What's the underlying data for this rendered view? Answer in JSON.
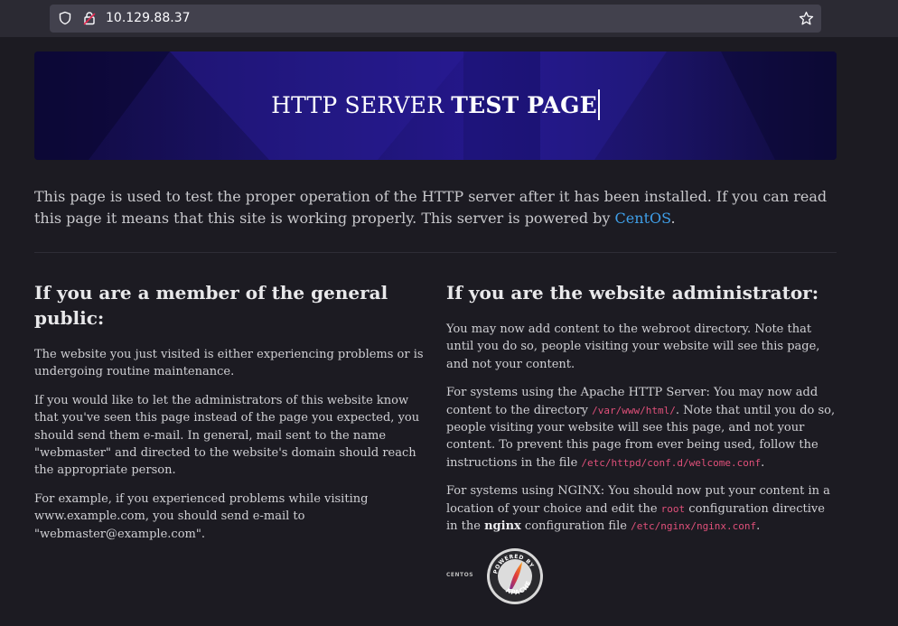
{
  "browser": {
    "url": "10.129.88.37"
  },
  "banner": {
    "title_light": "HTTP SERVER ",
    "title_bold": "TEST PAGE"
  },
  "intro": {
    "text_before_link": "This page is used to test the proper operation of the HTTP server after it has been installed. If you can read this page it means that this site is working properly. This server is powered by ",
    "link": "CentOS",
    "text_after_link": "."
  },
  "public": {
    "heading": "If you are a member of the general public:",
    "p1": "The website you just visited is either experiencing problems or is undergoing routine maintenance.",
    "p2": "If you would like to let the administrators of this website know that you've seen this page instead of the page you expected, you should send them e-mail. In general, mail sent to the name \"webmaster\" and directed to the website's domain should reach the appropriate person.",
    "p3": "For example, if you experienced problems while visiting www.example.com, you should send e-mail to \"webmaster@example.com\"."
  },
  "admin": {
    "heading": "If you are the website administrator:",
    "p1": "You may now add content to the webroot directory. Note that until you do so, people visiting your website will see this page, and not your content.",
    "p2_a": "For systems using the Apache HTTP Server: You may now add content to the directory ",
    "p2_code1": "/var/www/html/",
    "p2_b": ". Note that until you do so, people visiting your website will see this page, and not your content. To prevent this page from ever being used, follow the instructions in the file ",
    "p2_code2": "/etc/httpd/conf.d/welcome.conf",
    "p2_c": ".",
    "p3_a": "For systems using NGINX: You should now put your content in a location of your choice and edit the ",
    "p3_code1": "root",
    "p3_b": " configuration directive in the ",
    "p3_bold": "nginx",
    "p3_c": " configuration file ",
    "p3_code2": "/etc/nginx/nginx.conf",
    "p3_d": "."
  },
  "logos": {
    "centos": "CENTOS",
    "apache_top": "POWERED BY",
    "apache_bottom": "APACHE"
  },
  "icons": {
    "shield": "shield-icon",
    "lock": "insecure-lock-icon",
    "star": "bookmark-star-icon"
  },
  "colors": {
    "background": "#1c1b22",
    "link": "#3f9fe8",
    "code": "#e0507a",
    "banner": "#24178a"
  }
}
